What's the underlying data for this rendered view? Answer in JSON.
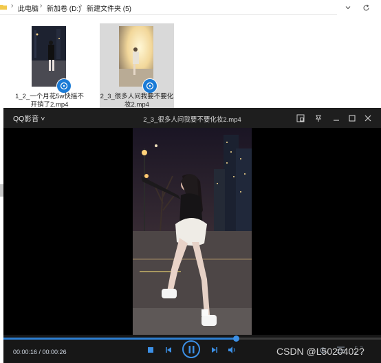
{
  "explorer": {
    "breadcrumbs": [
      "此电脑",
      "新加卷 (D:)",
      "新建文件夹 (5)"
    ],
    "breadcrumb_separator": "›",
    "files": [
      {
        "name": "1_2_一个月花5w快摇不开销了2.mp4",
        "selected": false
      },
      {
        "name": "2_3_很多人问我要不要化妆2.mp4",
        "selected": true
      }
    ],
    "file_badge_icon": "qq-video-file-icon"
  },
  "player": {
    "brand": "QQ影音",
    "brand_caret": "˅",
    "title": "2_3_很多人问我要不要化妆2.mp4",
    "time_display": "00:00:16 / 00:00:26",
    "progress": 0.615,
    "accent_color": "#2d7fd2",
    "window_icons": [
      "pip-icon",
      "pin-icon",
      "minimize-icon",
      "maximize-icon",
      "close-icon"
    ],
    "control_icons": [
      "stop-icon",
      "previous-icon",
      "pause-icon",
      "next-icon",
      "volume-icon",
      "settings-icon",
      "list-icon",
      "fullscreen-icon"
    ]
  },
  "watermark": "CSDN @L5020402?"
}
